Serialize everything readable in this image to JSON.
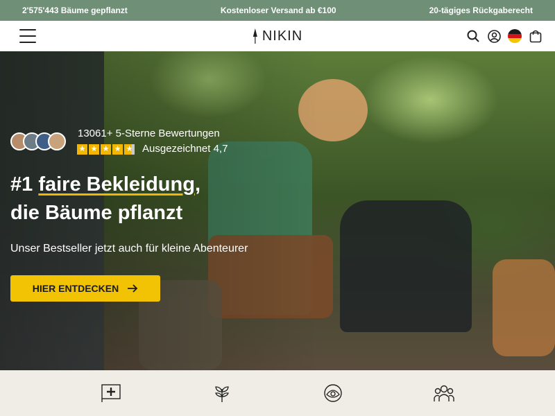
{
  "topbar": {
    "trees": "2'575'443 Bäume gepflanzt",
    "shipping": "Kostenloser Versand ab €100",
    "returns": "20-tägiges Rückgaberecht"
  },
  "header": {
    "logo": "NIKIN",
    "icons": [
      "menu-icon",
      "search-icon",
      "account-icon",
      "germany-flag-icon",
      "cart-icon"
    ]
  },
  "hero": {
    "rating_count": "13061+ 5-Sterne Bewertungen",
    "rating_label": "Ausgezeichnet 4,7",
    "rating_value": 4.7,
    "headline_pre": "#1 ",
    "headline_underlined": "faire Bekleidung",
    "headline_post": ",",
    "headline_line2": "die Bäume pflanzt",
    "subline": "Unser Bestseller jetzt auch für kleine Abenteurer",
    "cta": "HIER ENTDECKEN"
  },
  "features": [
    "swiss-flag-icon",
    "plant-icon",
    "eco-label-icon",
    "community-icon"
  ],
  "colors": {
    "topbar": "#6f8f77",
    "accent": "#f2c204",
    "star": "#f2b705",
    "feature_bg": "#efede6"
  }
}
